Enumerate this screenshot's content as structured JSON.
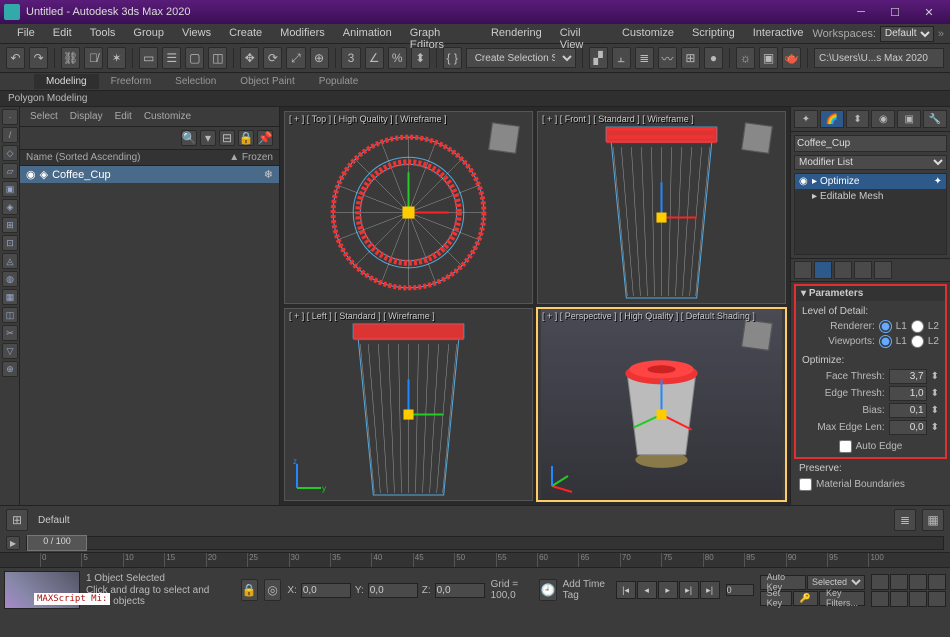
{
  "window": {
    "title": "Untitled - Autodesk 3ds Max 2020"
  },
  "menu": [
    "File",
    "Edit",
    "Tools",
    "Group",
    "Views",
    "Create",
    "Modifiers",
    "Animation",
    "Graph Editors",
    "Rendering",
    "Civil View",
    "Customize",
    "Scripting",
    "Interactive"
  ],
  "workspace": {
    "label": "Workspaces:",
    "value": "Default"
  },
  "toolbar": {
    "selection_set": "Create Selection Se",
    "path_field": "C:\\Users\\U...s Max 2020"
  },
  "ribbon": {
    "tabs": [
      "Modeling",
      "Freeform",
      "Selection",
      "Object Paint",
      "Populate"
    ],
    "sub": "Polygon Modeling"
  },
  "scene": {
    "tabs": [
      "Select",
      "Display",
      "Edit",
      "Customize"
    ],
    "cols": {
      "c1": "Name (Sorted Ascending)",
      "c2": "▲ Frozen"
    },
    "item": "Coffee_Cup"
  },
  "viewports": {
    "tl": "[ + ] [ Top ] [ High Quality ] [ Wireframe ]",
    "tr": "[ + ] [ Front ] [ Standard ] [ Wireframe ]",
    "bl": "[ + ] [ Left ] [ Standard ] [ Wireframe ]",
    "br": "[ + ] [ Perspective ] [ High Quality ] [ Default Shading ]"
  },
  "cmd": {
    "object_name": "Coffee_Cup",
    "modifier_list": "Modifier List",
    "stack": {
      "optimize": "Optimize",
      "editable": "Editable Mesh"
    },
    "params": {
      "title": "Parameters",
      "lod_title": "Level of Detail:",
      "renderer": "Renderer:",
      "viewports": "Viewports:",
      "l1": "L1",
      "l2": "L2",
      "optimize_title": "Optimize:",
      "face": "Face Thresh:",
      "face_v": "3,7",
      "edge": "Edge Thresh:",
      "edge_v": "1,0",
      "bias": "Bias:",
      "bias_v": "0,1",
      "maxedge": "Max Edge Len:",
      "maxedge_v": "0,0",
      "autoedge": "Auto Edge",
      "preserve": "Preserve:",
      "material": "Material Boundaries"
    }
  },
  "time": {
    "frame": "0 / 100",
    "ticks": [
      "0",
      "5",
      "10",
      "15",
      "20",
      "25",
      "30",
      "35",
      "40",
      "45",
      "50",
      "55",
      "60",
      "65",
      "70",
      "75",
      "80",
      "85",
      "90",
      "95",
      "100"
    ]
  },
  "status": {
    "selected": "1 Object Selected",
    "prompt": "Click and drag to select and move objects",
    "maxscript": "MAXScript Mi:",
    "x": "0,0",
    "y": "0,0",
    "z": "0,0",
    "grid": "Grid = 100,0",
    "add_time_tag": "Add Time Tag",
    "autokey": "Auto Key",
    "setkey": "Set Key",
    "selected_filter": "Selected",
    "keyfilters": "Key Filters..."
  }
}
